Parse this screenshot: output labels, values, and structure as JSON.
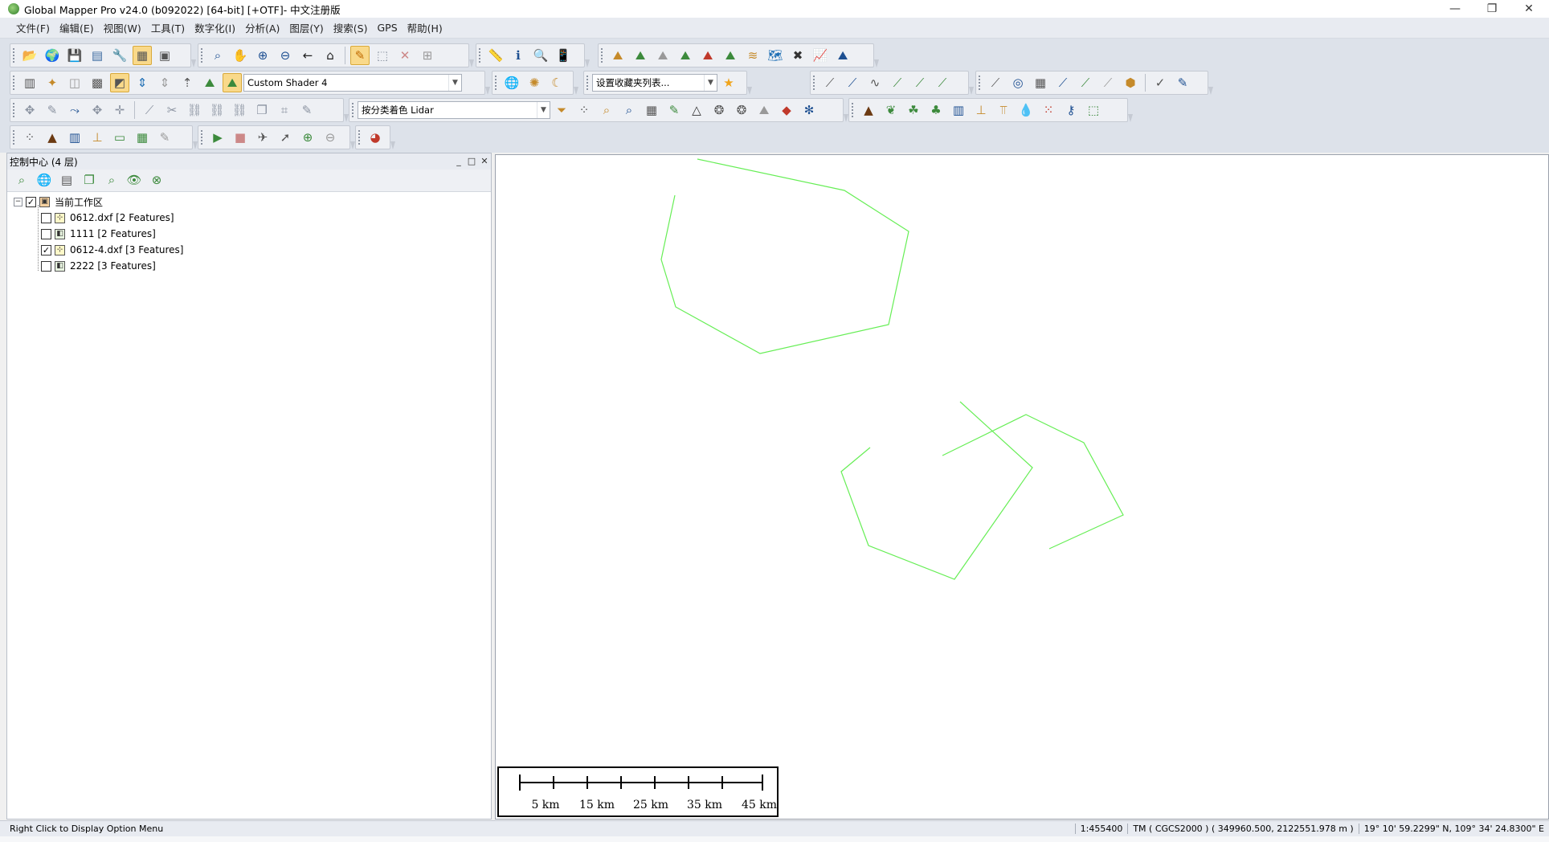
{
  "window": {
    "title": "Global Mapper Pro v24.0 (b092022) [64-bit] [+OTF]- 中文注册版",
    "minimize": "—",
    "restore": "❐",
    "close": "✕"
  },
  "menu": [
    "文件(F)",
    "编辑(E)",
    "视图(W)",
    "工具(T)",
    "数字化(I)",
    "分析(A)",
    "图层(Y)",
    "搜索(S)",
    "GPS",
    "帮助(H)"
  ],
  "toolbars": {
    "shader_combo": "Custom Shader 4",
    "favorites_combo": "设置收藏夹列表...",
    "lidar_combo": "按分类着色 Lidar"
  },
  "control_center": {
    "title": "控制中心 (4 层)",
    "minimize": "_",
    "float": "□",
    "close": "✕",
    "workspace_label": "当前工作区",
    "layers": [
      {
        "name": "0612.dxf [2 Features]",
        "checked": false,
        "icon": "vector-layer-icon"
      },
      {
        "name": "1111 [2 Features]",
        "checked": false,
        "icon": "picture-layer-icon"
      },
      {
        "name": "0612-4.dxf [3 Features]",
        "checked": true,
        "icon": "vector-layer-icon"
      },
      {
        "name": "2222 [3 Features]",
        "checked": false,
        "icon": "picture-layer-icon"
      }
    ]
  },
  "map": {
    "line_color": "#66ee55",
    "scale_labels": [
      "5 km",
      "15 km",
      "25 km",
      "35 km",
      "45 km"
    ]
  },
  "status": {
    "hint": "Right Click to Display Option Menu",
    "scale": "1:455400",
    "projection": "TM ( CGCS2000 ) ( 349960.500, 2122551.978 m )",
    "coords": "19° 10' 59.2299\" N, 109° 34' 24.8300\" E"
  }
}
